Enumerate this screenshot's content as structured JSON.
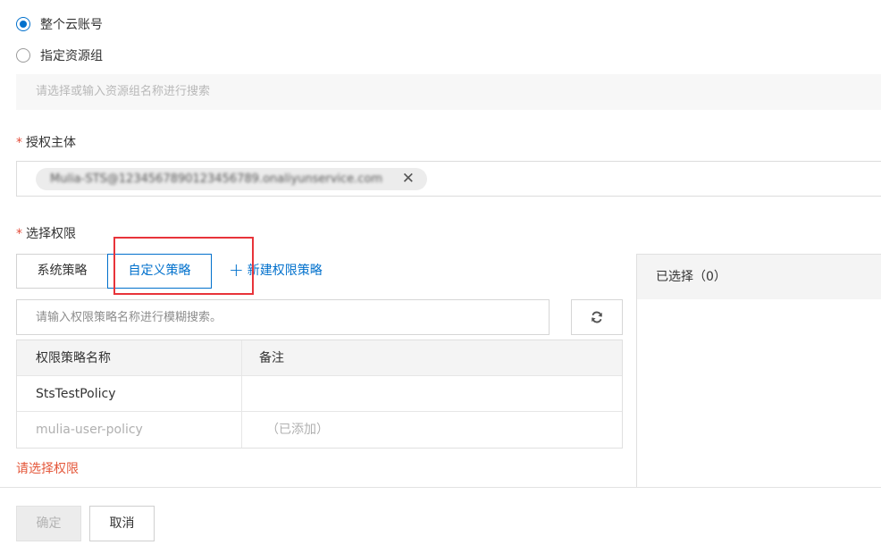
{
  "scope": {
    "options": [
      {
        "label": "整个云账号",
        "checked": true
      },
      {
        "label": "指定资源组",
        "checked": false
      }
    ],
    "resource_group_placeholder": "请选择或输入资源组名称进行搜索"
  },
  "principal": {
    "label": "授权主体",
    "required_mark": "*",
    "tag_text": "Mulia-STS@1234567890123456789.onaliyunservice.com",
    "tag_close": "✕"
  },
  "permissions": {
    "label": "选择权限",
    "required_mark": "*",
    "tabs": [
      {
        "label": "系统策略",
        "active": false
      },
      {
        "label": "自定义策略",
        "active": true
      }
    ],
    "new_policy_icon": "+",
    "new_policy_label": "新建权限策略",
    "search_placeholder": "请输入权限策略名称进行模糊搜索。",
    "table": {
      "headers": [
        "权限策略名称",
        "备注"
      ],
      "rows": [
        {
          "name": "StsTestPolicy",
          "note": ""
        },
        {
          "name": "mulia-user-policy",
          "note": "（已添加）"
        }
      ]
    },
    "error": "请选择权限",
    "selected_label": "已选择（0）"
  },
  "footer": {
    "confirm_label": "确定",
    "cancel_label": "取消"
  },
  "colors": {
    "accent": "#0070cc",
    "highlight": "#e8343a",
    "error": "#e4573a"
  }
}
